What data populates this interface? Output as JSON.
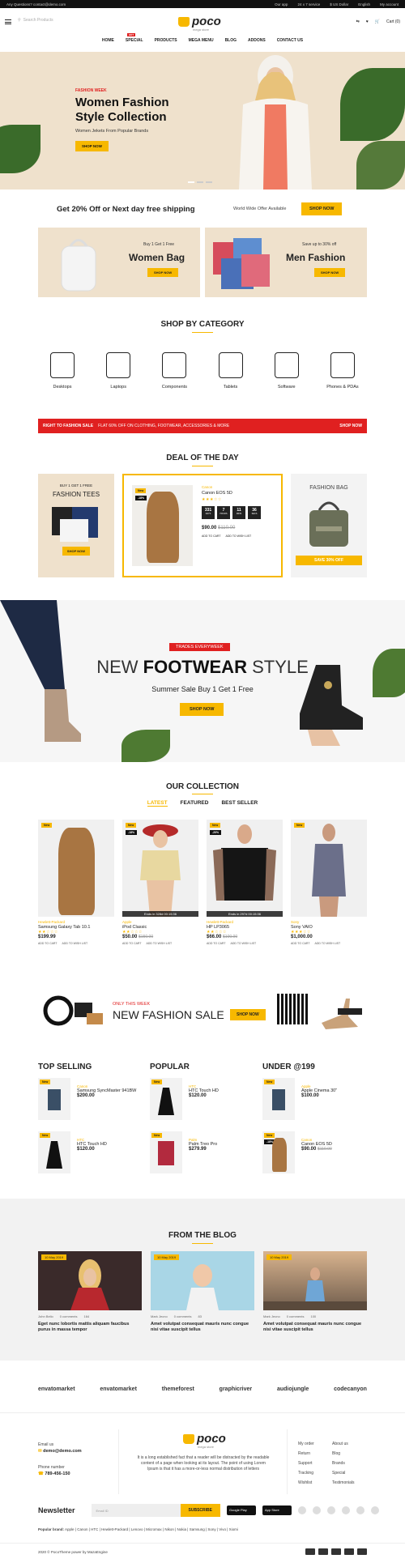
{
  "topbar": {
    "left": "Any Questions? contact@demo.com",
    "links": [
      "Our app",
      "24 x 7 service",
      "$ US Dollar",
      "English",
      "My account"
    ]
  },
  "header": {
    "search_placeholder": "Search Products",
    "logo": "poco",
    "logo_tag": "mega store",
    "cart": "Cart (0)"
  },
  "nav": [
    "HOME",
    "SPECIAL",
    "PRODUCTS",
    "MEGA MENU",
    "BLOG",
    "ADDONS",
    "CONTACT US"
  ],
  "nav_hot": "HOT",
  "hero": {
    "eyebrow": "FASHION WEEK",
    "title_1": "Women Fashion",
    "title_2": "Style Collection",
    "subtitle": "Women Jekets From Popular Brands",
    "button": "SHOP NOW"
  },
  "promo": {
    "headline": "Get 20% Off or Next day free shipping",
    "worldwide": "World Wide Offer Available",
    "button": "SHOP NOW"
  },
  "banner_women": {
    "small": "Buy 1 Get 1 Free",
    "big": "Women Bag",
    "button": "SHOP NOW"
  },
  "banner_men": {
    "small": "Save up to 30% off",
    "big": "Men Fashion",
    "button": "SHOP NOW"
  },
  "shop_by_category": {
    "title": "SHOP BY CATEGORY",
    "items": [
      "Desktops",
      "Laptops",
      "Components",
      "Tablets",
      "Software",
      "Phones & PDAs"
    ]
  },
  "salebar": {
    "label": "RIGHT TO FASHION SALE",
    "text": "FLAT 60% OFF ON CLOTHING, FOOTWEAR, ACCESSORIES & MORE",
    "cta": "SHOP NOW"
  },
  "deal": {
    "title": "DEAL OF THE DAY",
    "left_small": "BUY 1 GET 1 FREE",
    "left_big": "FASHION TEES",
    "left_btn": "SHOP NOW",
    "badge_new": "New",
    "badge_off": "-18%",
    "brand": "Canon",
    "name": "Canon EOS 5D",
    "countdown": [
      {
        "v": "331",
        "l": "DAYS"
      },
      {
        "v": "7",
        "l": "HOURS"
      },
      {
        "v": "11",
        "l": "MINS"
      },
      {
        "v": "36",
        "l": "SECS"
      }
    ],
    "price": "$90.00",
    "old_price": "$110.00",
    "add_to_cart": "ADD TO CART",
    "wishlist": "ADD TO WISH LIST",
    "right_title": "FASHION BAG",
    "right_btn": "SAVE 30% OFF"
  },
  "footwear": {
    "pill": "TRADES EVERYWEEK",
    "head_a": "NEW",
    "head_b": "FOOTWEAR",
    "head_c": "STYLE",
    "sub": "Summer Sale Buy 1 Get 1 Free",
    "button": "SHOP NOW"
  },
  "collection": {
    "title": "OUR COLLECTION",
    "tabs": [
      "LATEST",
      "FEATURED",
      "BEST SELLER"
    ],
    "products": [
      {
        "badge": "New",
        "off": "",
        "timer": "",
        "brand": "Hewlett-Packard",
        "name": "Samsung Galaxy Tab 10.1",
        "price": "$199.99",
        "old": ""
      },
      {
        "badge": "New",
        "off": "-18%",
        "timer": "Ends in 328d 00:15:36",
        "brand": "Apple",
        "name": "iPod Classic",
        "price": "$50.00",
        "old": "$150.00"
      },
      {
        "badge": "New",
        "off": "-20%",
        "timer": "Ends in 297d 00:15:36",
        "brand": "Hewlett-Packard",
        "name": "HP LP3065",
        "price": "$66.00",
        "old": "$100.00"
      },
      {
        "badge": "New",
        "off": "",
        "timer": "",
        "brand": "Sony",
        "name": "Sony VAIO",
        "price": "$1,000.00",
        "old": ""
      }
    ],
    "add_to_cart": "ADD TO CART",
    "wishlist": "ADD TO WISH LIST"
  },
  "fashion_sale": {
    "only": "ONLY THIS WEEK",
    "big": "NEW FASHION SALE",
    "button": "SHOP NOW"
  },
  "lists": [
    {
      "title": "TOP SELLING",
      "items": [
        {
          "brand": "Canon",
          "name": "Samsung SyncMaster 941BW",
          "price": "$200.00",
          "old": "",
          "off": ""
        },
        {
          "brand": "HTC",
          "name": "HTC Touch HD",
          "price": "$120.00",
          "old": "",
          "off": ""
        }
      ]
    },
    {
      "title": "POPULAR",
      "items": [
        {
          "brand": "HTC",
          "name": "HTC Touch HD",
          "price": "$120.00",
          "old": "",
          "off": ""
        },
        {
          "brand": "Palm",
          "name": "Palm Treo Pro",
          "price": "$279.99",
          "old": "",
          "off": ""
        }
      ]
    },
    {
      "title": "UNDER @199",
      "items": [
        {
          "brand": "Apple",
          "name": "Apple Cinema 30\"",
          "price": "$100.00",
          "old": "",
          "off": ""
        },
        {
          "brand": "Canon",
          "name": "Canon EOS 5D",
          "price": "$90.00",
          "old": "$110.00",
          "off": "-18%"
        }
      ]
    }
  ],
  "list_badge": "New",
  "blog": {
    "title": "FROM THE BLOG",
    "posts": [
      {
        "date": "10 May 2019",
        "author": "John Bello",
        "comments": "0 comments",
        "views": "164",
        "title": "Eget nunc lobortis mattis aliquam faucibus purus in massa tempor"
      },
      {
        "date": "10 May 2019",
        "author": "Mark Jecno",
        "comments": "0 comments",
        "views": "83",
        "title": "Amet volutpat consequat mauris nunc congue nisi vitae suscipit tellus"
      },
      {
        "date": "10 May 2019",
        "author": "Mark Jecno",
        "comments": "0 comments",
        "views": "100",
        "title": "Amet volutpat consequat mauris nunc congue nisi vitae suscipit tellus"
      }
    ]
  },
  "brands": [
    "envatomarket",
    "envatomarket",
    "themeforest",
    "graphicriver",
    "audiojungle",
    "codecanyon"
  ],
  "footer": {
    "email_label": "Email us",
    "email": "demo@demo.com",
    "phone_label": "Phone number",
    "phone": "789-456-150",
    "about": "It is a long established fact that a reader will be distracted by the readable content of a page when looking at its layout. The point of using Lorem Ipsum is that it has a more-or-less normal distribution of letters",
    "col1": [
      "My order",
      "Return",
      "Support",
      "Tracking",
      "Wishlist"
    ],
    "col2": [
      "About us",
      "Blog",
      "Brands",
      "Special",
      "Testimonials"
    ]
  },
  "newsletter": {
    "title": "Newsletter",
    "placeholder": "Email ID",
    "button": "SUBSCRIBE",
    "google": "Google Play",
    "apple": "App Store"
  },
  "popular_brands": {
    "label": "Popular brand:",
    "list": "Apple | Canon | HTC | Hewlett-Packard | Lenovo | Micromax | Nikon | Nokia | Samsung | Sony | Vivo | Xiomi"
  },
  "copyright": "2020 © PocoTheme power by MazaEngine",
  "colors": {
    "accent": "#f7b800",
    "sale": "#e02020",
    "beige": "#efe1cc"
  }
}
